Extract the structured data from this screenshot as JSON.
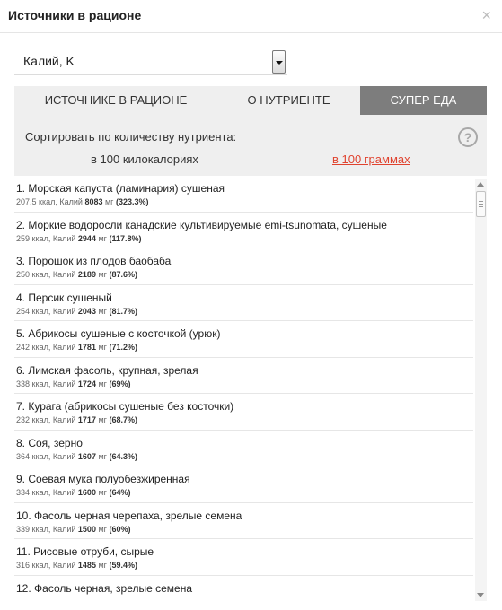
{
  "header": {
    "title": "Источники в рационе",
    "close_symbol": "×"
  },
  "nutrient_select": {
    "value": "Калий, K"
  },
  "tabs": [
    {
      "label": "ИСТОЧНИКЕ В РАЦИОНЕ",
      "active": false
    },
    {
      "label": "О НУТРИЕНТЕ",
      "active": false
    },
    {
      "label": "СУПЕР ЕДА",
      "active": true
    }
  ],
  "sort": {
    "label": "Сортировать по количеству нутриента:",
    "per_kcal": "в 100 килокалориях",
    "per_grams": "в 100 граммах",
    "help_symbol": "?"
  },
  "items": [
    {
      "name": "1. Морская капуста (ламинария) сушеная",
      "kcal": "207.5 ккал, Калий",
      "amount": "8083",
      "unit": "мг",
      "percent": "(323.3%)"
    },
    {
      "name": "2. Моркие водоросли канадские культивируемые emi-tsunomata, сушеные",
      "kcal": "259 ккал, Калий",
      "amount": "2944",
      "unit": "мг",
      "percent": "(117.8%)"
    },
    {
      "name": "3. Порошок из плодов баобаба",
      "kcal": "250 ккал, Калий",
      "amount": "2189",
      "unit": "мг",
      "percent": "(87.6%)"
    },
    {
      "name": "4. Персик сушеный",
      "kcal": "254 ккал, Калий",
      "amount": "2043",
      "unit": "мг",
      "percent": "(81.7%)"
    },
    {
      "name": "5. Абрикосы сушеные с косточкой (урюк)",
      "kcal": "242 ккал, Калий",
      "amount": "1781",
      "unit": "мг",
      "percent": "(71.2%)"
    },
    {
      "name": "6. Лимская фасоль, крупная, зрелая",
      "kcal": "338 ккал, Калий",
      "amount": "1724",
      "unit": "мг",
      "percent": "(69%)"
    },
    {
      "name": "7. Курага (абрикосы сушеные без косточки)",
      "kcal": "232 ккал, Калий",
      "amount": "1717",
      "unit": "мг",
      "percent": "(68.7%)"
    },
    {
      "name": "8. Соя, зерно",
      "kcal": "364 ккал, Калий",
      "amount": "1607",
      "unit": "мг",
      "percent": "(64.3%)"
    },
    {
      "name": "9. Соевая мука полуобезжиренная",
      "kcal": "334 ккал, Калий",
      "amount": "1600",
      "unit": "мг",
      "percent": "(64%)"
    },
    {
      "name": "10. Фасоль черная черепаха, зрелые семена",
      "kcal": "339 ккал, Калий",
      "amount": "1500",
      "unit": "мг",
      "percent": "(60%)"
    },
    {
      "name": "11. Рисовые отруби, сырые",
      "kcal": "316 ккал, Калий",
      "amount": "1485",
      "unit": "мг",
      "percent": "(59.4%)"
    },
    {
      "name": "12. Фасоль черная, зрелые семена",
      "kcal": "",
      "amount": "",
      "unit": "",
      "percent": ""
    }
  ],
  "colors": {
    "active_tab": "#7d7d7d",
    "link": "#e0432f",
    "panel": "#efefef"
  }
}
